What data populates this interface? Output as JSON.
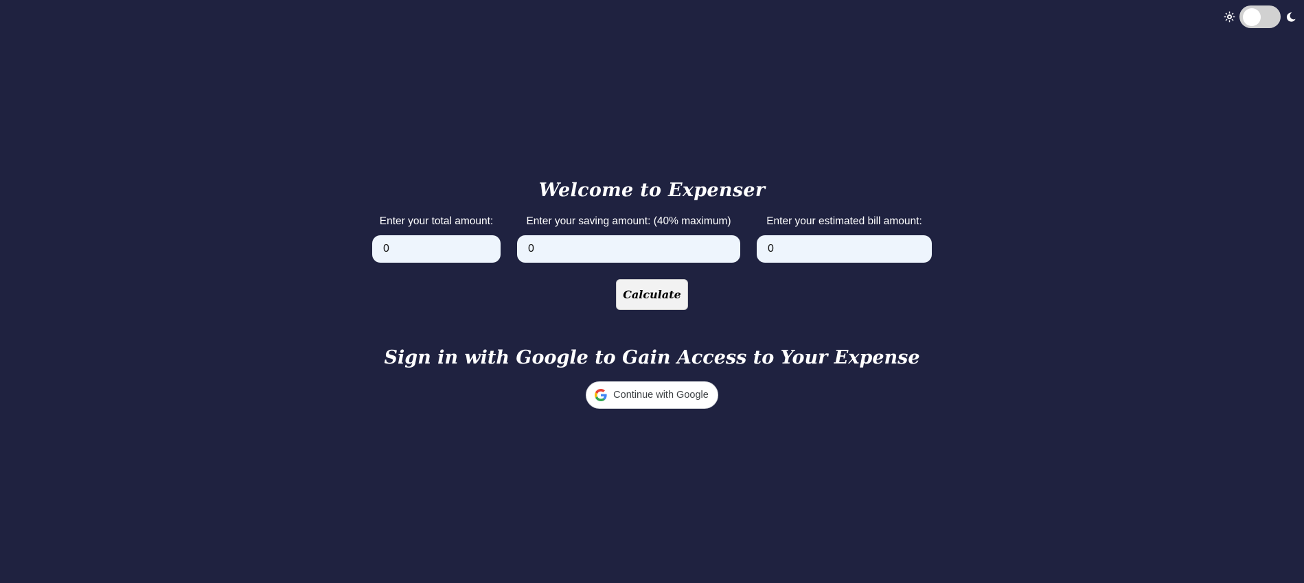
{
  "theme_toggle": {
    "left_icon": "sun-icon",
    "right_icon": "moon-icon",
    "state": "light"
  },
  "main": {
    "title": "Welcome to Expenser",
    "fields": [
      {
        "label": "Enter your total amount:",
        "value": "0"
      },
      {
        "label": "Enter your saving amount: (40% maximum)",
        "value": "0"
      },
      {
        "label": "Enter your estimated bill amount:",
        "value": "0"
      }
    ],
    "calculate_label": "Calculate",
    "signin_heading": "Sign in with Google to Gain Access to Your Expense",
    "google_button_label": "Continue with Google",
    "google_icon": "google-icon"
  },
  "colors": {
    "background": "#1f2240",
    "input_background": "#eef5fd",
    "text": "#ffffff"
  }
}
